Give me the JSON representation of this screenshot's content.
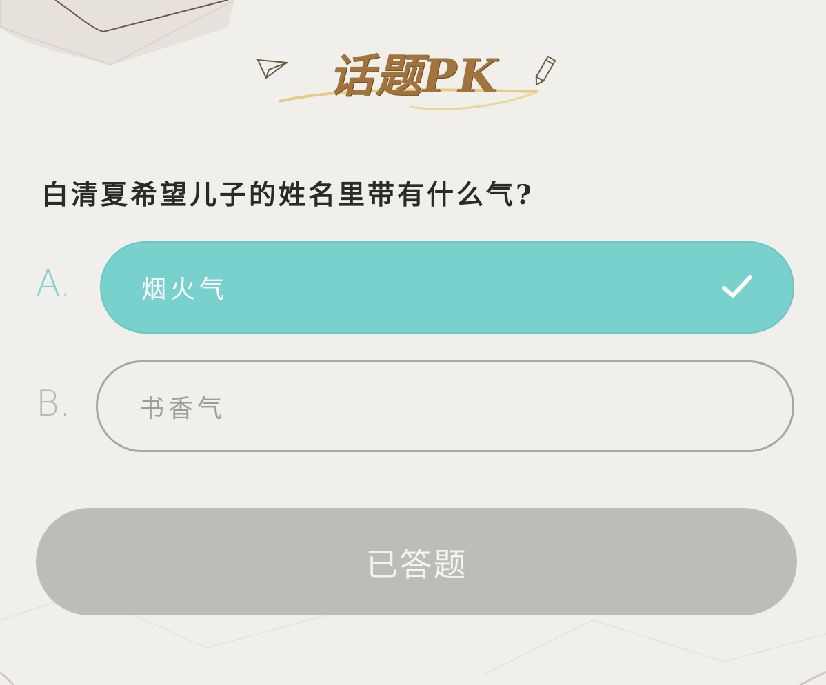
{
  "header": {
    "logo_text": "话题PK"
  },
  "question": {
    "text": "白清夏希望儿子的姓名里带有什么气?"
  },
  "options": [
    {
      "letter": "A.",
      "text": "烟火气",
      "selected": true
    },
    {
      "letter": "B.",
      "text": "书香气",
      "selected": false
    }
  ],
  "submit": {
    "label": "已答题"
  },
  "colors": {
    "selected_bg": "#78d1cd",
    "selected_letter": "#7dd3cf",
    "unselected_border": "#a8a69d",
    "submit_bg": "#bdbcb9",
    "logo_gold": "#a0743c"
  },
  "icons": {
    "check": "check-icon",
    "paper_plane": "paper-plane-icon",
    "pencil": "pencil-icon"
  }
}
